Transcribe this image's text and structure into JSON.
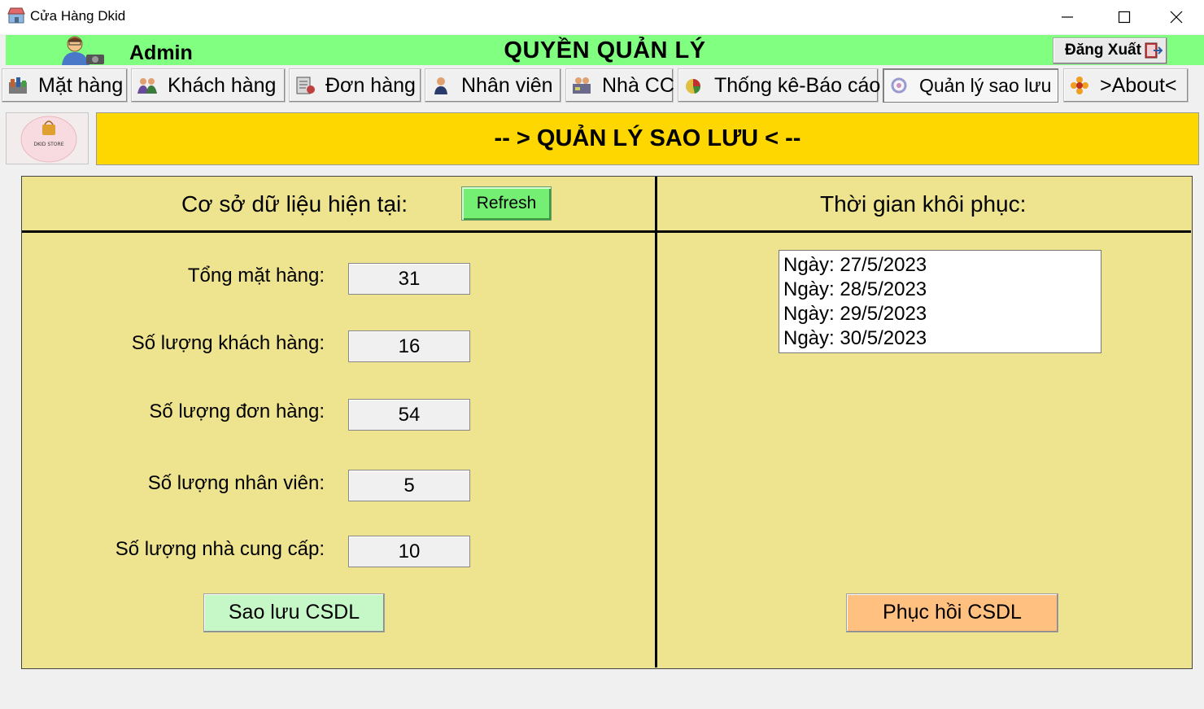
{
  "window": {
    "title": "Cửa Hàng Dkid",
    "app_icon": "store-icon",
    "controls": [
      "minimize-icon",
      "maximize-icon",
      "close-icon"
    ]
  },
  "header": {
    "user_name": "Admin",
    "role_title": "QUYỀN QUẢN LÝ",
    "logout_label": "Đăng Xuất",
    "background_color": "#80ff80"
  },
  "tabs": [
    {
      "label": "Mặt hàng",
      "icon": "store-shelves-icon"
    },
    {
      "label": "Khách hàng",
      "icon": "customers-icon"
    },
    {
      "label": "Đơn hàng",
      "icon": "order-icon"
    },
    {
      "label": "Nhân viên",
      "icon": "employee-icon"
    },
    {
      "label": "Nhà CC",
      "icon": "supplier-icon"
    },
    {
      "label": "Thống kê-Báo cáo",
      "icon": "report-icon"
    },
    {
      "label": "Quản lý sao lưu",
      "icon": "backup-icon",
      "active": true
    },
    {
      "label": ">About<",
      "icon": "flower-icon"
    }
  ],
  "logo": {
    "text": "DKID STORE",
    "icon": "shopping-bag-icon"
  },
  "banner": {
    "title": "-- > QUẢN LÝ SAO LƯU < --",
    "color": "#ffd700"
  },
  "current_db": {
    "title": "Cơ sở dữ liệu hiện tại:",
    "refresh_label": "Refresh",
    "stats": [
      {
        "label": "Tổng mặt hàng:",
        "value": "31"
      },
      {
        "label": "Số lượng khách hàng:",
        "value": "16"
      },
      {
        "label": "Số lượng đơn hàng:",
        "value": "54"
      },
      {
        "label": "Số lượng nhân viên:",
        "value": "5"
      },
      {
        "label": "Số lượng nhà cung cấp:",
        "value": "10"
      }
    ],
    "backup_label": "Sao lưu CSDL"
  },
  "restore": {
    "title": "Thời gian khôi phục:",
    "dates": [
      "Ngày: 27/5/2023",
      "Ngày: 28/5/2023",
      "Ngày: 29/5/2023",
      "Ngày: 30/5/2023"
    ],
    "restore_label": "Phục hồi CSDL"
  },
  "colors": {
    "panel": "#eee48f",
    "refresh_button": "#74ef74",
    "backup_button": "#c6f7c6",
    "restore_button": "#ffc080"
  }
}
